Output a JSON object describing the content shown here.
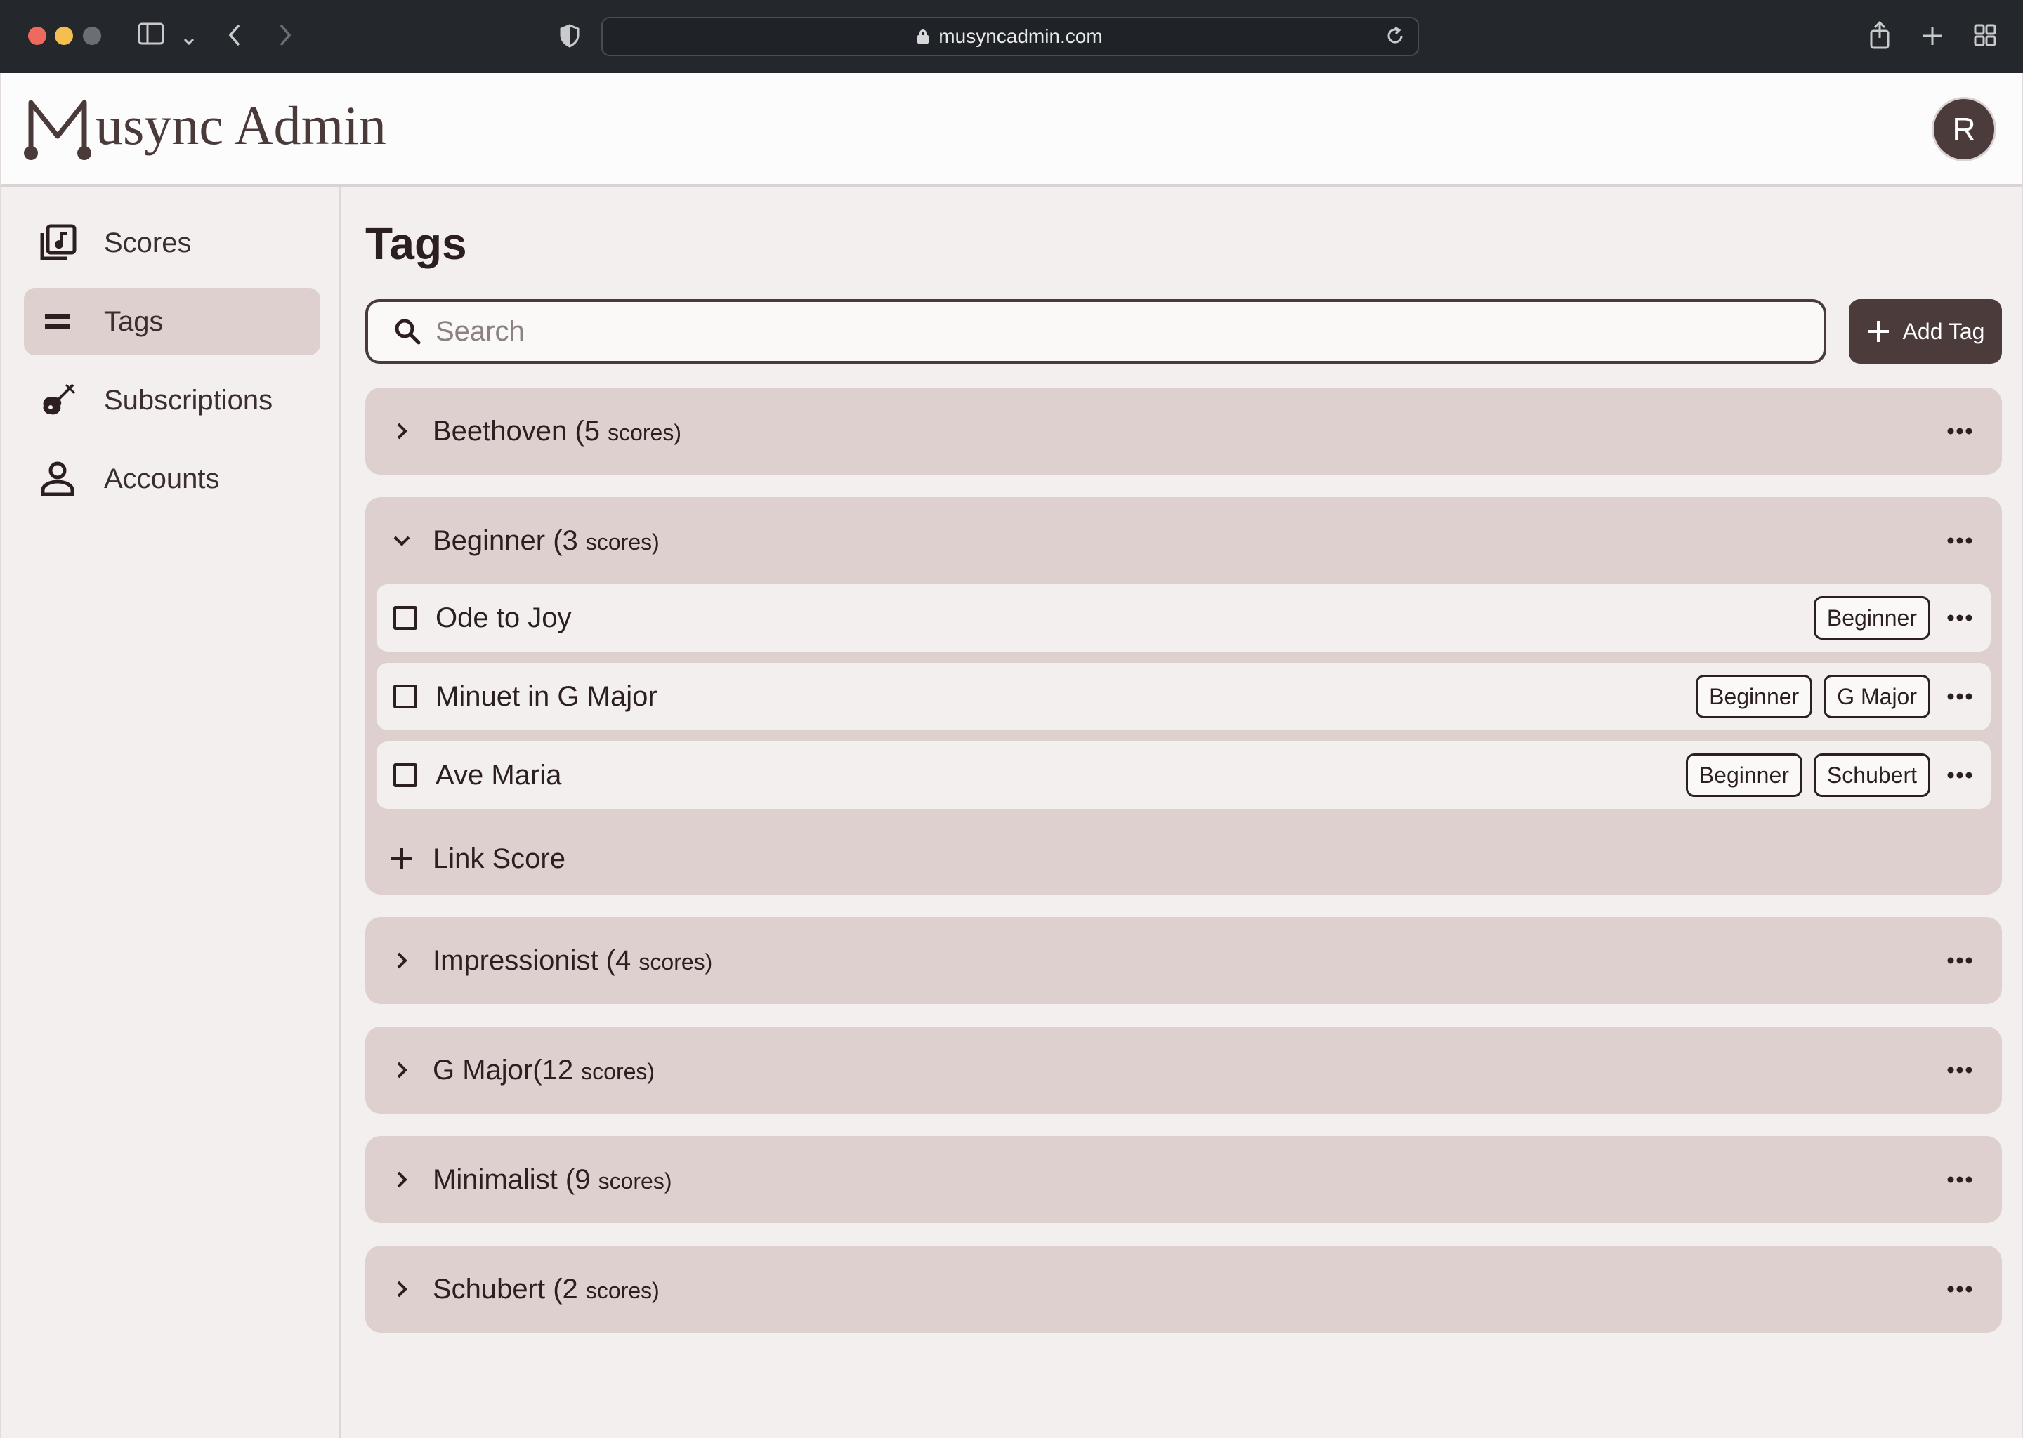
{
  "browser": {
    "url": "musyncadmin.com"
  },
  "header": {
    "logo_text": "usync Admin",
    "avatar_initial": "R"
  },
  "sidebar": {
    "items": [
      {
        "label": "Scores",
        "icon": "library-music-icon",
        "active": false
      },
      {
        "label": "Tags",
        "icon": "equal-icon",
        "active": true
      },
      {
        "label": "Subscriptions",
        "icon": "violin-icon",
        "active": false
      },
      {
        "label": "Accounts",
        "icon": "person-icon",
        "active": false
      }
    ]
  },
  "main": {
    "title": "Tags",
    "search_placeholder": "Search",
    "add_tag_label": "Add Tag",
    "link_score_label": "Link Score",
    "tags": [
      {
        "name": "Beethoven (5 ",
        "count": "scores)",
        "expanded": false
      },
      {
        "name": "Beginner (3 ",
        "count": "scores)",
        "expanded": true
      },
      {
        "name": "Impressionist (4 ",
        "count": "scores)",
        "expanded": false
      },
      {
        "name": "G Major(12 ",
        "count": "scores)",
        "expanded": false
      },
      {
        "name": "Minimalist (9 ",
        "count": "scores)",
        "expanded": false
      },
      {
        "name": "Schubert (2 ",
        "count": "scores)",
        "expanded": false
      }
    ],
    "beginner_scores": [
      {
        "title": "Ode to Joy",
        "tags": [
          "Beginner"
        ]
      },
      {
        "title": "Minuet in G Major",
        "tags": [
          "Beginner",
          "G Major"
        ]
      },
      {
        "title": "Ave Maria",
        "tags": [
          "Beginner",
          "Schubert"
        ]
      }
    ]
  },
  "colors": {
    "brand_dark": "#4b3b3b",
    "panel": "#ddd0ce",
    "background": "#f4efef"
  }
}
